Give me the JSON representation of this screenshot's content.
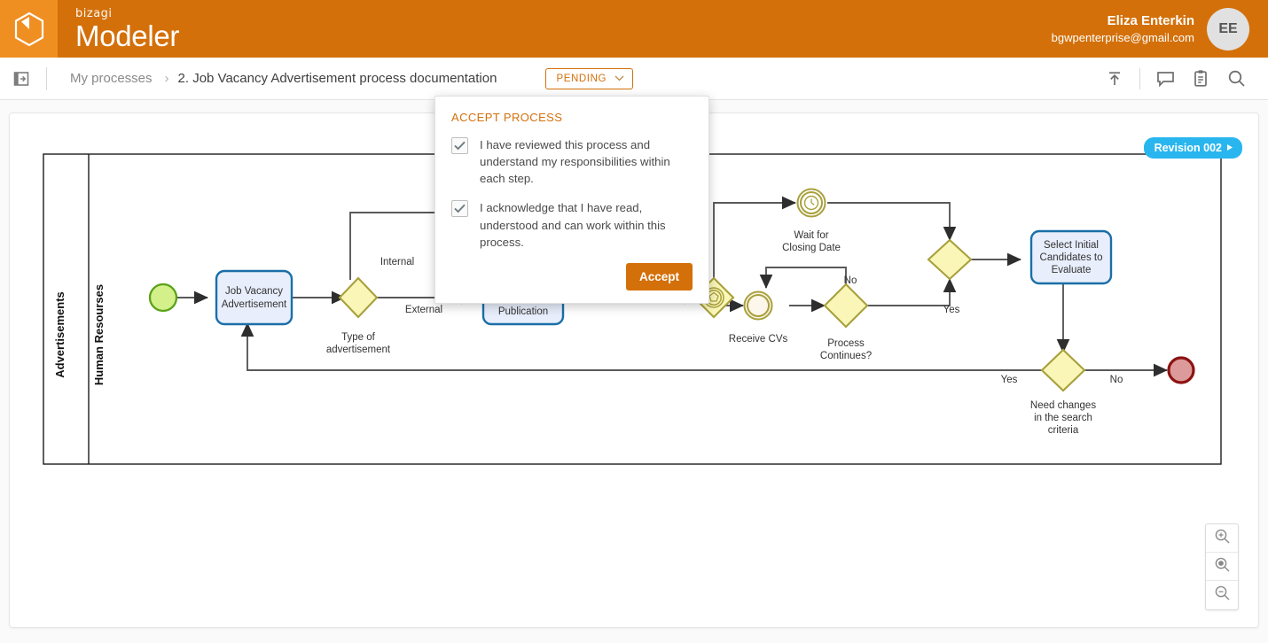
{
  "header": {
    "logo_icon": "bizagi-cube-icon",
    "brand_small": "bizagi",
    "brand_big": "Modeler",
    "user_name": "Eliza Enterkin",
    "user_email": "bgwpenterprise@gmail.com",
    "avatar_initials": "EE",
    "bg_color": "#d4700a",
    "logo_bg_color": "#ef8f22"
  },
  "subheader": {
    "panel_toggle_icon": "panel-expand-icon",
    "breadcrumb_root": "My processes",
    "breadcrumb_separator": "›",
    "breadcrumb_current": "2. Job Vacancy Advertisement process documentation",
    "status_label": "PENDING",
    "status_caret_icon": "chevron-down-icon",
    "tools": [
      {
        "name": "publish-icon",
        "label": "Publish"
      },
      {
        "name": "comment-icon",
        "label": "Comments"
      },
      {
        "name": "clipboard-icon",
        "label": "Tasks"
      },
      {
        "name": "search-icon",
        "label": "Search"
      }
    ]
  },
  "canvas": {
    "revision_label": "Revision 002",
    "revision_caret_icon": "play-triangle-icon",
    "revision_color": "#29b6ef",
    "zoom_buttons": [
      {
        "name": "zoom-in-button",
        "icon": "magnifier-plus-icon"
      },
      {
        "name": "zoom-reset-button",
        "icon": "magnifier-dot-icon"
      },
      {
        "name": "zoom-out-button",
        "icon": "magnifier-minus-icon"
      }
    ]
  },
  "diagram": {
    "pool_name": "Advertisements",
    "lane_name": "Human Resourses",
    "nodes": [
      {
        "id": "start",
        "type": "start-event",
        "label": ""
      },
      {
        "id": "task1",
        "type": "user-task",
        "label": "Job Vacancy Advertisement"
      },
      {
        "id": "gw-type",
        "type": "exclusive-gateway",
        "label": "Type of advertisement"
      },
      {
        "id": "task2",
        "type": "script-task",
        "label": "External Advertisement Publication"
      },
      {
        "id": "gw-event",
        "type": "event-based-gateway",
        "label": ""
      },
      {
        "id": "timer",
        "type": "timer-intermediate-event",
        "label": "Wait for Closing Date"
      },
      {
        "id": "receive",
        "type": "message-intermediate-event",
        "label": "Receive CVs"
      },
      {
        "id": "gw-continues",
        "type": "exclusive-gateway",
        "label": "Process Continues?"
      },
      {
        "id": "gw-join",
        "type": "exclusive-gateway",
        "label": ""
      },
      {
        "id": "task3",
        "type": "user-task",
        "label": "Select Initial Candidates to Evaluate"
      },
      {
        "id": "gw-changes",
        "type": "exclusive-gateway",
        "label": "Need changes in the search criteria"
      },
      {
        "id": "end",
        "type": "end-event",
        "label": ""
      }
    ],
    "flow_labels": [
      {
        "id": "f-internal",
        "text": "Internal"
      },
      {
        "id": "f-external",
        "text": "External"
      },
      {
        "id": "f-no-1",
        "text": "No"
      },
      {
        "id": "f-yes-1",
        "text": "Yes"
      },
      {
        "id": "f-yes-2",
        "text": "Yes"
      },
      {
        "id": "f-no-2",
        "text": "No"
      }
    ],
    "colors": {
      "task_fill": "#e8eefb",
      "task_stroke": "#1a6fa8",
      "gateway_fill": "#f9f6b8",
      "gateway_stroke": "#a8a03c",
      "start_fill": "#d4f08a",
      "start_stroke": "#5aa218",
      "end_fill": "#dd9a9a",
      "end_stroke": "#8c1212",
      "flow_stroke": "#595959"
    }
  },
  "modal": {
    "title": "ACCEPT PROCESS",
    "checkbox1": {
      "checked": true,
      "label": "I have reviewed this process and understand my responsibilities within each step."
    },
    "checkbox2": {
      "checked": true,
      "label": "I acknowledge that I have read, understood and can work within this process."
    },
    "accept_label": "Accept",
    "accent_color": "#d4700a"
  }
}
